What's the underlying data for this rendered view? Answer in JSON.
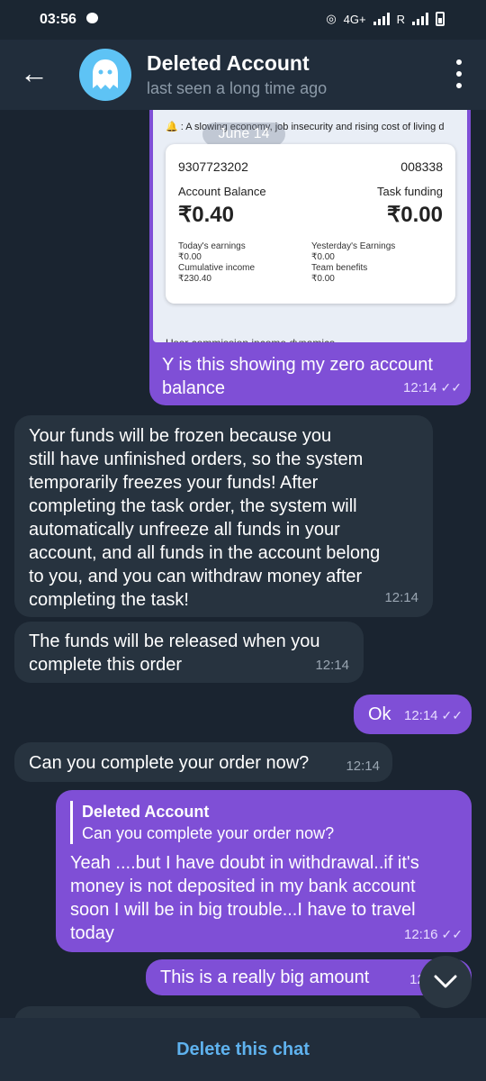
{
  "status": {
    "time": "03:56",
    "network": "4G+",
    "carrier": "R"
  },
  "header": {
    "title": "Deleted Account",
    "subtitle": "last seen a long time ago"
  },
  "screenshot": {
    "notice": ": A slowing economy, job insecurity and rising cost of living d",
    "date_pill": "June 14",
    "account_no": "9307723202",
    "code": "008338",
    "balance_label": "Account Balance",
    "task_funding_label": "Task funding",
    "balance": "₹0.40",
    "task_funding": "₹0.00",
    "today_earnings_label": "Today's earnings",
    "today_earnings": "₹0.00",
    "yesterday_earnings_label": "Yesterday's Earnings",
    "yesterday_earnings": "₹0.00",
    "cumulative_label": "Cumulative income",
    "cumulative": "₹230.40",
    "team_label": "Team benefits",
    "team": "₹0.00",
    "footer": "User commission income dynamics"
  },
  "messages": [
    {
      "dir": "out",
      "lines": [
        "Y is this showing my zero account",
        "balance"
      ],
      "time": "12:14"
    },
    {
      "dir": "in",
      "lines": [
        "Your funds will be frozen because you",
        "still have unfinished orders, so the system",
        "temporarily freezes your funds! After",
        "completing the task order, the system will",
        "automatically unfreeze all funds in your",
        "account, and all funds in the account belong",
        "to you, and you can withdraw money after",
        "completing the task!"
      ],
      "time": "12:14"
    },
    {
      "dir": "in",
      "lines": [
        "The funds will be released when you",
        "complete this order"
      ],
      "time": "12:14"
    },
    {
      "dir": "out",
      "lines": [
        "Ok"
      ],
      "time": "12:14"
    },
    {
      "dir": "in",
      "lines": [
        "Can you complete your order now?"
      ],
      "time": "12:14"
    },
    {
      "dir": "out",
      "reply_name": "Deleted Account",
      "reply_text": "Can you complete your order now?",
      "lines": [
        "Yeah ....but I have doubt in withdrawal..if it's",
        "money is not deposited in my bank account",
        "soon I will be in big trouble...I have to travel",
        "today"
      ],
      "time": "12:16"
    },
    {
      "dir": "out",
      "lines": [
        "This is a really big amount"
      ],
      "time": "12:"
    }
  ],
  "bottom": {
    "action": "Delete this chat"
  },
  "colors": {
    "header": "#212d3b",
    "outgoing": "#7f4fd6",
    "incoming": "#27333f",
    "accent": "#5fb2ee"
  }
}
